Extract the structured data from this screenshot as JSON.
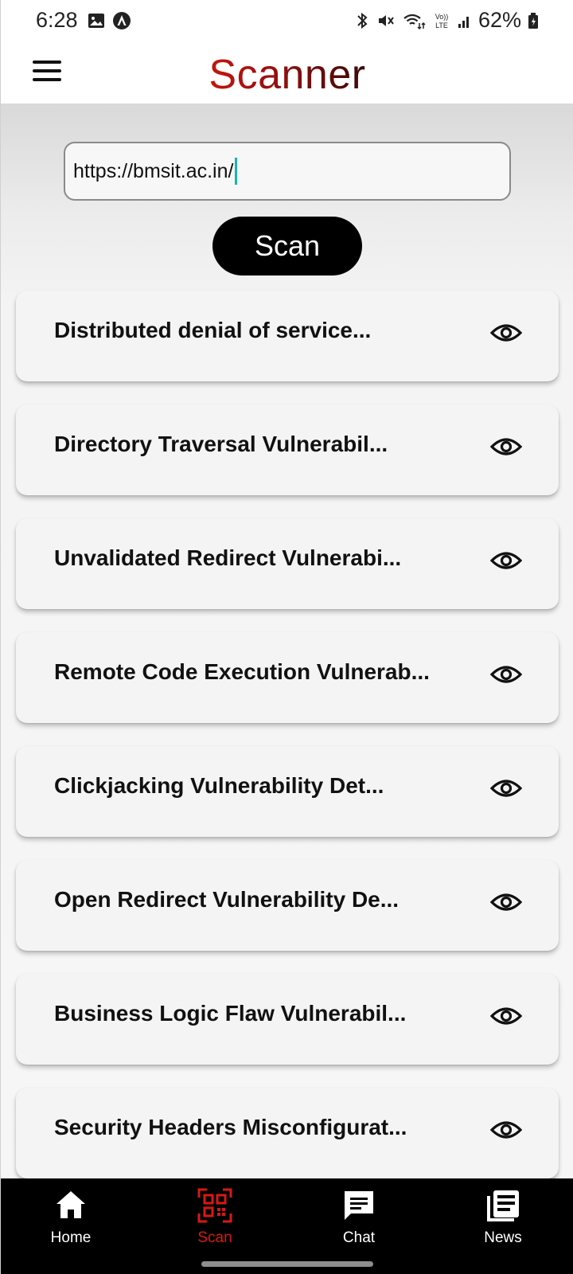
{
  "status_bar": {
    "time": "6:28",
    "battery": "62%",
    "left_icons": [
      "image-icon",
      "app-notification-icon"
    ],
    "right_icons": [
      "bluetooth-icon",
      "mute-icon",
      "wifi-icon",
      "volte-icon",
      "signal-icon",
      "battery-icon"
    ],
    "volte_text": "Vo)) LTE"
  },
  "header": {
    "title": "Scanner",
    "menu_icon": "hamburger-menu-icon",
    "title_colors": [
      "#c8140e",
      "#3a0808"
    ]
  },
  "scan_form": {
    "url_value": "https://bmsit.ac.in/",
    "scan_label": "Scan"
  },
  "results": [
    {
      "title": "Distributed denial of service..."
    },
    {
      "title": "Directory Traversal Vulnerabil..."
    },
    {
      "title": "Unvalidated Redirect Vulnerabi..."
    },
    {
      "title": "Remote Code Execution Vulnerab..."
    },
    {
      "title": "Clickjacking Vulnerability Det..."
    },
    {
      "title": "Open Redirect Vulnerability De..."
    },
    {
      "title": "Business Logic Flaw Vulnerabil..."
    },
    {
      "title": "Security Headers Misconfigurat..."
    }
  ],
  "bottom_nav": {
    "items": [
      {
        "label": "Home",
        "icon": "home-icon"
      },
      {
        "label": "Scan",
        "icon": "qr-scan-icon",
        "active": true
      },
      {
        "label": "Chat",
        "icon": "chat-icon"
      },
      {
        "label": "News",
        "icon": "news-icon"
      }
    ],
    "active_color": "#d61a12"
  }
}
